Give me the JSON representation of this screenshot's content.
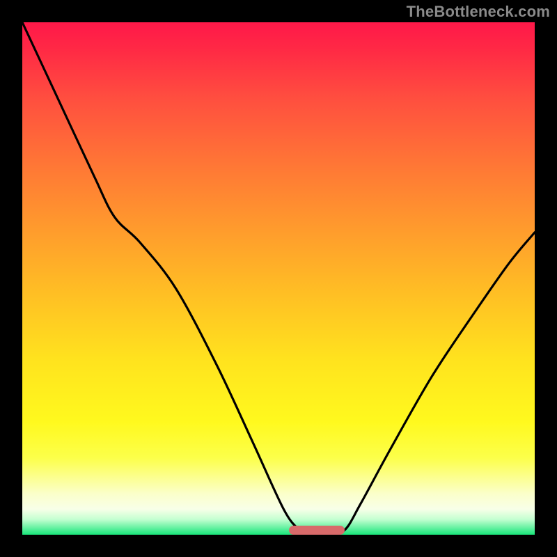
{
  "attribution": "TheBottleneck.com",
  "colors": {
    "frame": "#000000",
    "curve": "#000000",
    "marker": "#d86a6a",
    "gradient_top": "#ff1849",
    "gradient_bottom": "#18e67a"
  },
  "chart_data": {
    "type": "line",
    "title": "",
    "xlabel": "",
    "ylabel": "",
    "xlim": [
      0,
      100
    ],
    "ylim": [
      0,
      100
    ],
    "notes": "x is a normalized hardware-balance axis (0–100, no visible ticks); y is bottleneck % (0 at bottom = no bottleneck, 100 at top = full bottleneck). Background gradient runs red→yellow→green top→bottom.",
    "curve_points": [
      {
        "x": 0,
        "y": 100
      },
      {
        "x": 7,
        "y": 85
      },
      {
        "x": 14,
        "y": 70
      },
      {
        "x": 18,
        "y": 62
      },
      {
        "x": 23,
        "y": 57
      },
      {
        "x": 30,
        "y": 48
      },
      {
        "x": 38,
        "y": 33
      },
      {
        "x": 45,
        "y": 18
      },
      {
        "x": 51,
        "y": 5
      },
      {
        "x": 54,
        "y": 1
      },
      {
        "x": 56,
        "y": 0
      },
      {
        "x": 60,
        "y": 0
      },
      {
        "x": 63,
        "y": 1
      },
      {
        "x": 66,
        "y": 6
      },
      {
        "x": 72,
        "y": 17
      },
      {
        "x": 80,
        "y": 31
      },
      {
        "x": 88,
        "y": 43
      },
      {
        "x": 95,
        "y": 53
      },
      {
        "x": 100,
        "y": 59
      }
    ],
    "optimal_range_x": [
      53,
      63
    ],
    "marker": {
      "shape": "rounded-bar",
      "color": "#d86a6a",
      "x_range": [
        53,
        63
      ],
      "y": 0
    }
  }
}
